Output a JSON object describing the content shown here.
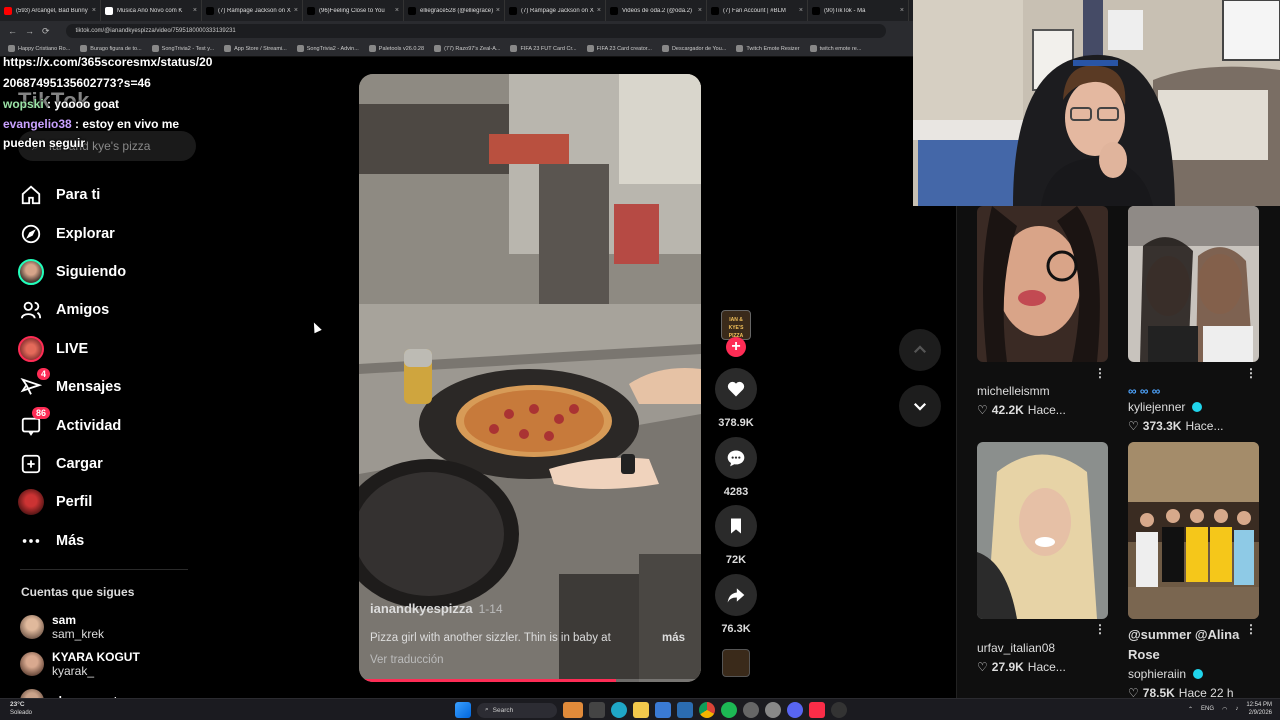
{
  "browser": {
    "tabs": [
      {
        "label": "(593) Arcangel, Bad Bunny",
        "color": "#ff0000"
      },
      {
        "label": "Musica Ano Novo com K",
        "color": "#ffffff"
      },
      {
        "label": "(7) Rampage Jackson on X",
        "color": "#000000"
      },
      {
        "label": "(96)Feeling Close to You",
        "color": "#000000"
      },
      {
        "label": "elliegrace528 (@elliegrace)",
        "color": "#000000"
      },
      {
        "label": "(7) Rampage Jackson on X",
        "color": "#000000"
      },
      {
        "label": "Videos de oda.2 (@oda.2)",
        "color": "#000000"
      },
      {
        "label": "(7) Fan Account | #BLM",
        "color": "#000000"
      },
      {
        "label": "(90)TikTok - Ma",
        "color": "#000000"
      }
    ],
    "url": "tiktok.com/@ianandkyespizza/video/7595180000333139231",
    "bookmarks": [
      "Happy Cristiano Ro...",
      "Burago figura de to...",
      "SongTrivia2 - Test y...",
      "App Store / Streami...",
      "SongTrivia2 - Advin...",
      "Paletools v26.0.28",
      "(77) Razo97's Zeal-A...",
      "FIFA 23 FUT Card Cr...",
      "FIFA 23 Card creator...",
      "Descargador de You...",
      "Twitch Emote Resizer",
      "twitch emote re..."
    ]
  },
  "chat": {
    "messages": [
      {
        "user": "",
        "text": "https://x.com/365scoresmx/status/2020687495135602773?s=46"
      },
      {
        "user": "wopski",
        "text": "yoooo goat"
      },
      {
        "user": "evangelio38",
        "text": "estoy en vivo me pueden seguir"
      }
    ]
  },
  "sidebar": {
    "logo": "TikTok",
    "search_placeholder": "Ian and kye's pizza",
    "items": [
      {
        "label": "Para ti",
        "icon": "home-icon"
      },
      {
        "label": "Explorar",
        "icon": "compass-icon"
      },
      {
        "label": "Siguiendo",
        "icon": "avatar-icon"
      },
      {
        "label": "Amigos",
        "icon": "friends-icon"
      },
      {
        "label": "LIVE",
        "icon": "live-icon"
      },
      {
        "label": "Mensajes",
        "icon": "messages-icon",
        "badge": "4"
      },
      {
        "label": "Actividad",
        "icon": "activity-icon",
        "badge": "86"
      },
      {
        "label": "Cargar",
        "icon": "upload-icon"
      },
      {
        "label": "Perfil",
        "icon": "profile-icon"
      },
      {
        "label": "Más",
        "icon": "more-icon"
      }
    ],
    "following_title": "Cuentas que sigues",
    "following": [
      {
        "name": "sam",
        "handle": "sam_krek"
      },
      {
        "name": "KYARA KOGUT",
        "handle": "kyarak_"
      },
      {
        "name": "alessaamot",
        "handle": ""
      }
    ]
  },
  "video": {
    "author": "ianandkyespizza",
    "date": "1-14",
    "caption": "Pizza girl with another sizzler. Thin is in baby at",
    "more": "más",
    "translate": "Ver traducción",
    "progress": 0.75
  },
  "actions": {
    "avatar_text": "IAN & KYE'S PIZZA",
    "likes": "378.9K",
    "comments": "4283",
    "saves": "72K",
    "shares": "76.3K"
  },
  "suggested": [
    {
      "name": "michelleismm",
      "likes": "42.2K",
      "time": "Hace..."
    },
    {
      "name": "kyliejenner",
      "prefix": "∞ ∞ ∞",
      "likes": "373.3K",
      "time": "Hace...",
      "verified": true
    },
    {
      "name": "urfav_italian08",
      "likes": "27.9K",
      "time": "Hace..."
    },
    {
      "name": "sophieraiin",
      "title": "@summer @Alina Rose",
      "likes": "78.5K",
      "time": "Hace 22 h",
      "verified": true
    }
  ],
  "taskbar": {
    "weather_temp": "23°C",
    "weather_desc": "Soleado",
    "search": "Search",
    "lang": "ENG",
    "time": "12:54 PM",
    "date": "2/9/2026"
  },
  "colors": {
    "accent": "#fe2c55",
    "background": "#000000",
    "verified": "#20d5ec"
  }
}
